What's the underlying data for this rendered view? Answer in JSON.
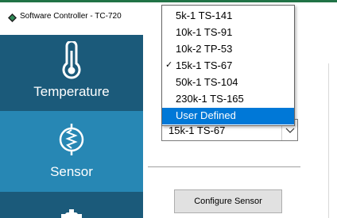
{
  "window": {
    "title": "Software Controller - TC-720",
    "accent_color": "#217346"
  },
  "sidebar": {
    "colors": {
      "background": "#1b5a7a",
      "active": "#2787b4"
    },
    "items": [
      {
        "label": "Temperature",
        "icon": "thermometer-icon",
        "active": false
      },
      {
        "label": "Sensor",
        "icon": "thermistor-icon",
        "active": true
      },
      {
        "label": "",
        "icon": "gear-icon",
        "active": false
      }
    ]
  },
  "sensor_select": {
    "value": "15k-1 TS-67",
    "options": [
      {
        "label": "5k-1 TS-141",
        "checked": false,
        "highlighted": false
      },
      {
        "label": "10k-1 TS-91",
        "checked": false,
        "highlighted": false
      },
      {
        "label": "10k-2 TP-53",
        "checked": false,
        "highlighted": false
      },
      {
        "label": "15k-1 TS-67",
        "checked": true,
        "highlighted": false
      },
      {
        "label": "50k-1 TS-104",
        "checked": false,
        "highlighted": false
      },
      {
        "label": "230k-1 TS-165",
        "checked": false,
        "highlighted": false
      },
      {
        "label": "User Defined",
        "checked": false,
        "highlighted": true
      }
    ],
    "check_glyph": "✓",
    "highlight_color": "#0078d7"
  },
  "configure_button": {
    "label": "Configure Sensor"
  }
}
